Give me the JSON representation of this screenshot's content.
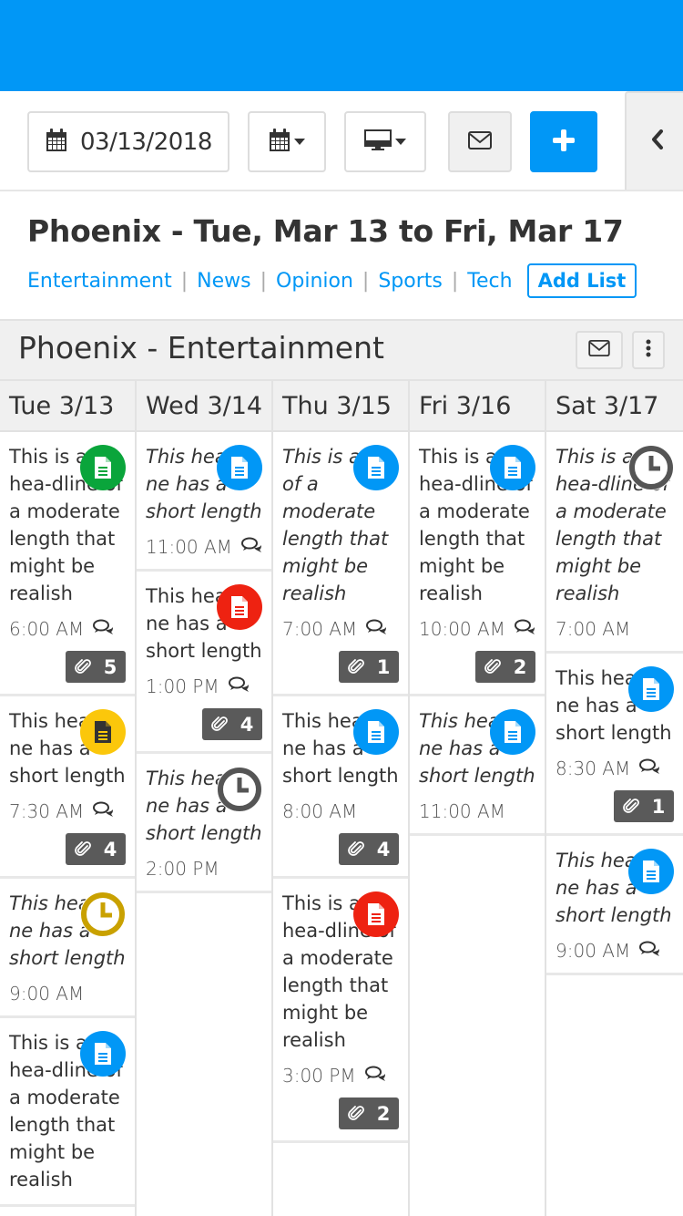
{
  "toolbar": {
    "date_value": "03/13/2018",
    "calendar_icon": "calendar-icon",
    "display_icon": "desktop-icon",
    "mail_icon": "envelope-icon",
    "add_icon": "plus-icon",
    "collapse_icon": "chevron-left-icon"
  },
  "header": {
    "title": "Phoenix - Tue, Mar 13 to Fri, Mar 17",
    "lists": [
      "Entertainment",
      "News",
      "Opinion",
      "Sports",
      "Tech"
    ],
    "add_list_label": "Add List"
  },
  "section": {
    "title": "Phoenix - Entertainment",
    "mail_icon": "envelope-icon",
    "more_icon": "vertical-ellipsis-icon"
  },
  "colors": {
    "brand_blue": "#0197f6",
    "green": "#0aa53b",
    "red": "#ee2211",
    "yellow": "#fbc70b",
    "gold": "#c9a100",
    "gray": "#555555"
  },
  "days": [
    {
      "label": "Tue 3/13",
      "cards": [
        {
          "headline": "This is a hea-dline of a moderate length that might be realish",
          "italic": false,
          "icon": "document",
          "icon_color": "green",
          "time": "6:00 AM",
          "comments": true,
          "attachments": "5"
        },
        {
          "headline": "This headli-ne has a short length",
          "italic": false,
          "icon": "document",
          "icon_color": "yellow",
          "time": "7:30 AM",
          "comments": true,
          "attachments": "4"
        },
        {
          "headline": "This headli-ne has a short length",
          "italic": true,
          "icon": "clock",
          "icon_color": "gold",
          "time": "9:00 AM",
          "comments": false,
          "attachments": null
        },
        {
          "headline": "This is a hea-dline of a moderate length that might be realish",
          "italic": false,
          "icon": "document",
          "icon_color": "blue",
          "time": null,
          "comments": false,
          "attachments": null
        }
      ]
    },
    {
      "label": "Wed 3/14",
      "cards": [
        {
          "headline": "This headli-ne has a short length",
          "italic": true,
          "icon": "document",
          "icon_color": "blue",
          "time": "11:00 AM",
          "comments": true,
          "attachments": null
        },
        {
          "headline": "This headli-ne has a short length",
          "italic": false,
          "icon": "document",
          "icon_color": "red",
          "time": "1:00 PM",
          "comments": true,
          "attachments": "4"
        },
        {
          "headline": "This headli-ne has a short length",
          "italic": true,
          "icon": "clock",
          "icon_color": "gray",
          "time": "2:00 PM",
          "comments": false,
          "attachments": null
        }
      ]
    },
    {
      "label": "Thu 3/15",
      "cards": [
        {
          "headline": "This is a ne of a moderate length that might be realish",
          "italic": true,
          "icon": "document",
          "icon_color": "blue",
          "time": "7:00 AM",
          "comments": true,
          "attachments": "1"
        },
        {
          "headline": "This headli-ne has a short length",
          "italic": false,
          "icon": "document",
          "icon_color": "blue",
          "time": "8:00 AM",
          "comments": false,
          "attachments": "4"
        },
        {
          "headline": "This is a hea-dline of a moderate length that might be realish",
          "italic": false,
          "icon": "document",
          "icon_color": "red",
          "time": "3:00 PM",
          "comments": true,
          "attachments": "2"
        }
      ]
    },
    {
      "label": "Fri 3/16",
      "cards": [
        {
          "headline": "This is a hea-dline of a moderate length that might be realish",
          "italic": false,
          "icon": "document",
          "icon_color": "blue",
          "time": "10:00 AM",
          "comments": true,
          "attachments": "2"
        },
        {
          "headline": "This headli-ne has a short length",
          "italic": true,
          "icon": "document",
          "icon_color": "blue",
          "time": "11:00 AM",
          "comments": false,
          "attachments": null
        }
      ]
    },
    {
      "label": "Sat 3/17",
      "cards": [
        {
          "headline": "This is a hea-dline of a moderate length that might be realish",
          "italic": true,
          "icon": "clock",
          "icon_color": "gray",
          "time": "7:00 AM",
          "comments": false,
          "attachments": null
        },
        {
          "headline": "This headli-ne has a short length",
          "italic": false,
          "icon": "document",
          "icon_color": "blue",
          "time": "8:30 AM",
          "comments": true,
          "attachments": "1"
        },
        {
          "headline": "This headli-ne has a short length",
          "italic": true,
          "icon": "document",
          "icon_color": "blue",
          "time": "9:00 AM",
          "comments": true,
          "attachments": null
        }
      ]
    }
  ]
}
